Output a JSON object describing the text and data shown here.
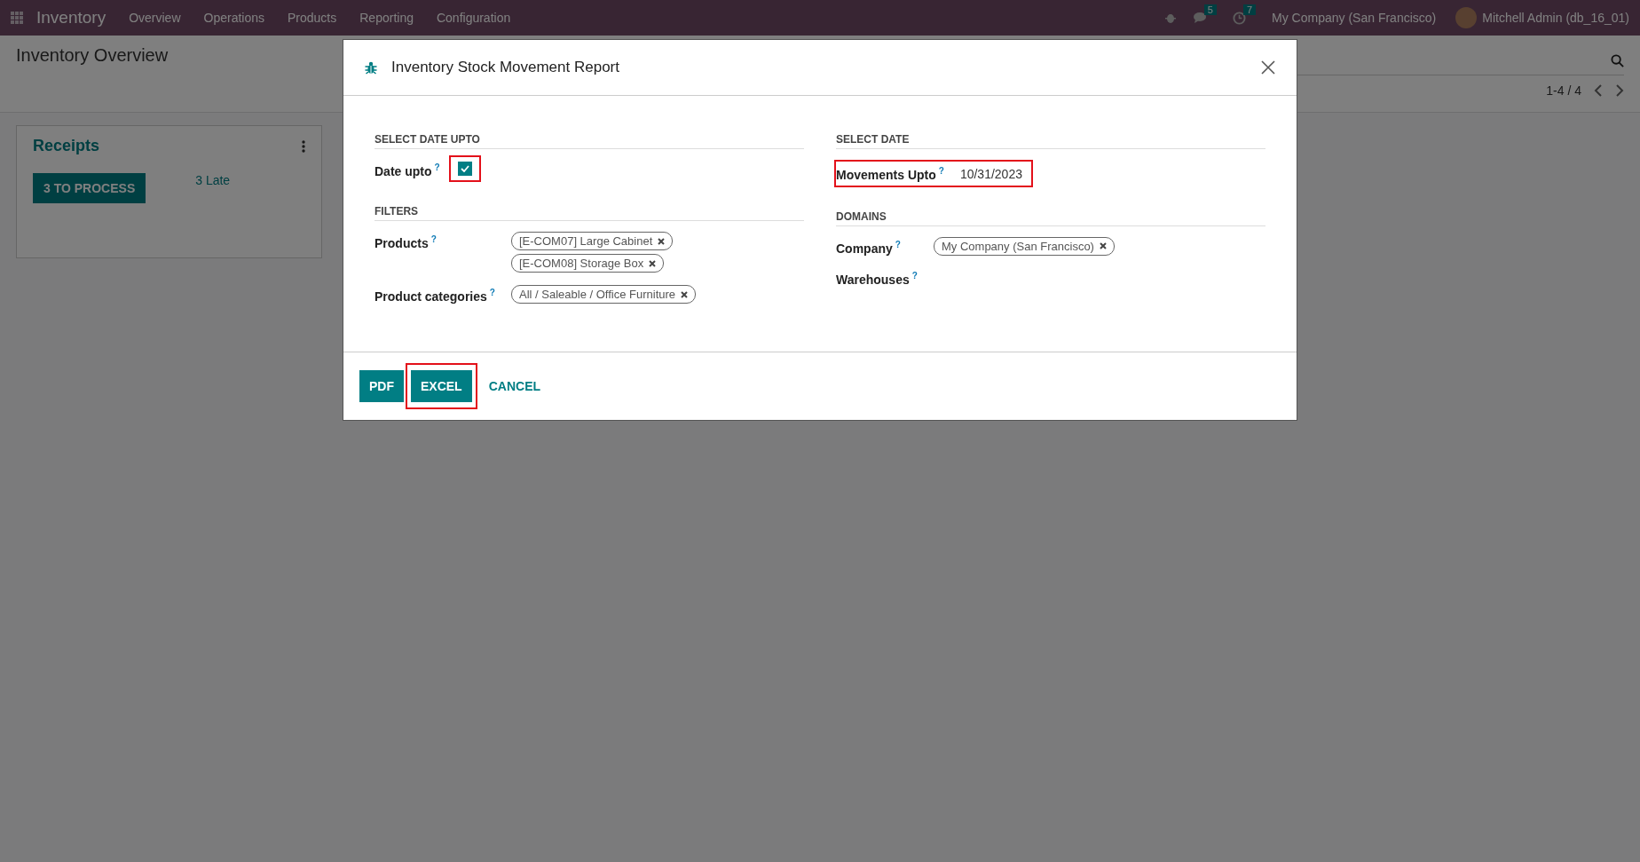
{
  "navbar": {
    "app": "Inventory",
    "menu": [
      "Overview",
      "Operations",
      "Products",
      "Reporting",
      "Configuration"
    ],
    "messages_count": "5",
    "activities_count": "7",
    "company": "My Company (San Francisco)",
    "user": "Mitchell Admin (db_16_01)"
  },
  "page": {
    "title": "Inventory Overview",
    "pager": "1-4 / 4"
  },
  "cards": [
    {
      "title": "Receipts",
      "action": "3 TO PROCESS",
      "late": "3 Late"
    }
  ],
  "dialog": {
    "title": "Inventory Stock Movement Report",
    "columns": [
      [
        {
          "heading": "SELECT DATE UPTO",
          "fields": [
            {
              "kind": "checkbox",
              "label": "Date upto",
              "help": "?",
              "checked": true,
              "highlighted": true
            }
          ]
        },
        {
          "heading": "FILTERS",
          "fields": [
            {
              "kind": "tags",
              "label": "Products",
              "help": "?",
              "tags": [
                "[E-COM07] Large Cabinet",
                "[E-COM08] Storage Box"
              ]
            },
            {
              "kind": "tags",
              "label": "Product categories",
              "help": "?",
              "tags": [
                "All / Saleable / Office Furniture"
              ]
            }
          ]
        }
      ],
      [
        {
          "heading": "SELECT DATE",
          "fields": [
            {
              "kind": "date",
              "label": "Movements Upto",
              "help": "?",
              "value": "10/31/2023",
              "highlighted": true
            }
          ]
        },
        {
          "heading": "DOMAINS",
          "fields": [
            {
              "kind": "tags",
              "label": "Company",
              "help": "?",
              "tags": [
                "My Company (San Francisco)"
              ]
            },
            {
              "kind": "tags",
              "label": "Warehouses",
              "help": "?"
            }
          ]
        }
      ]
    ],
    "buttons": [
      {
        "label": "PDF",
        "kind": "primary",
        "highlighted": false
      },
      {
        "label": "EXCEL",
        "kind": "primary",
        "highlighted": true
      },
      {
        "label": "CANCEL",
        "kind": "link",
        "highlighted": false
      }
    ]
  }
}
